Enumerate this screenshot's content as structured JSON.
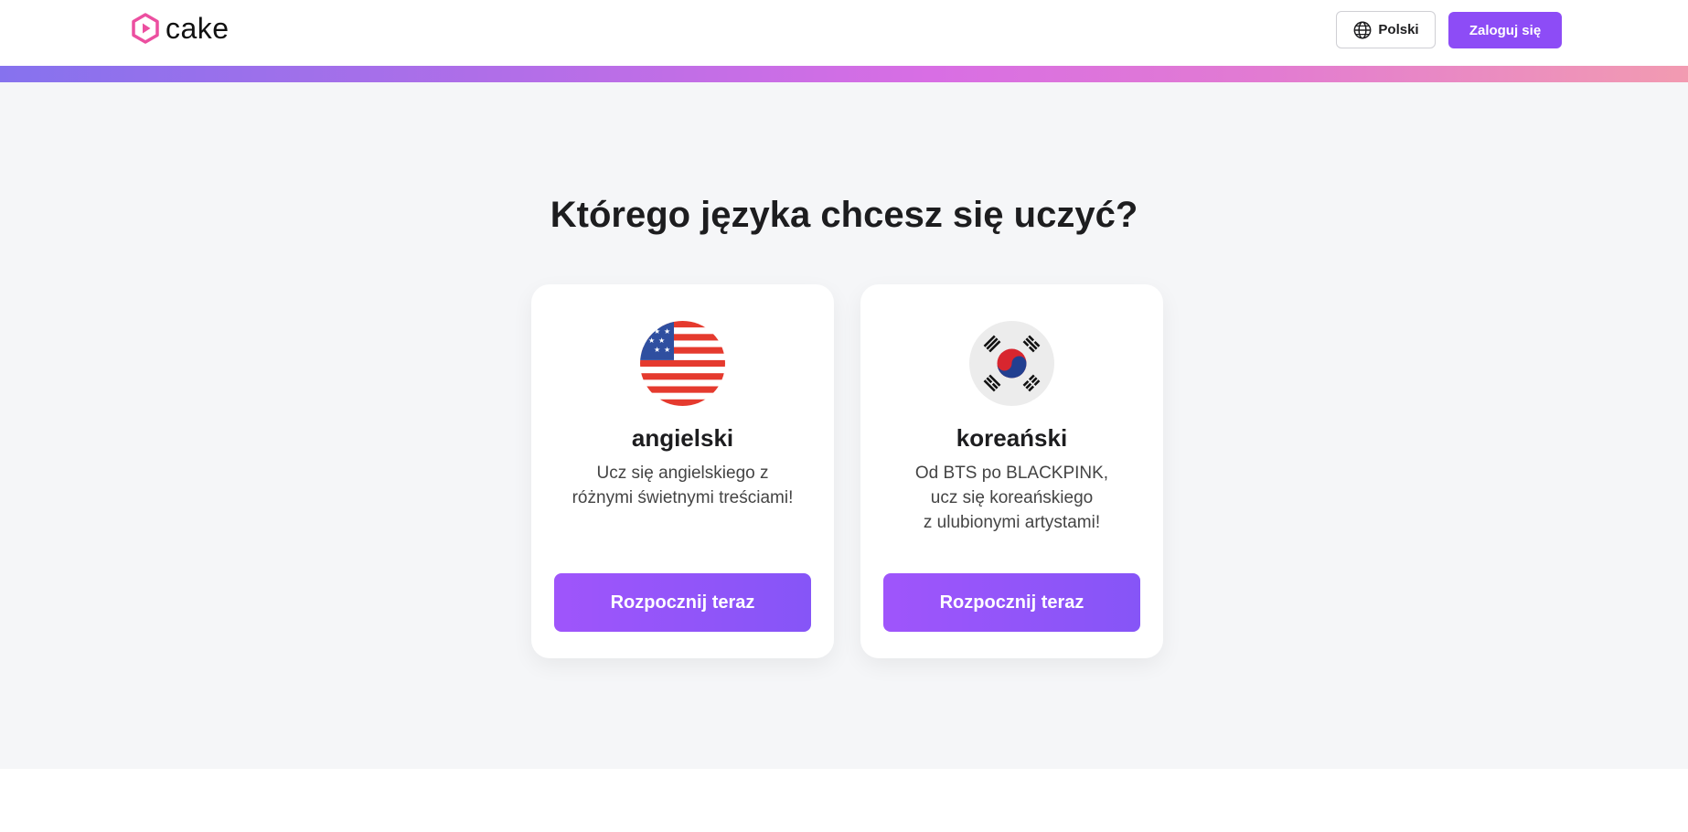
{
  "brand": {
    "name": "cake",
    "logo_icon": "hexagon-play-icon",
    "color": "#ec4fa0"
  },
  "header": {
    "language_button": {
      "label": "Polski",
      "icon": "globe-icon"
    },
    "login_button": {
      "label": "Zaloguj się"
    },
    "accent": "#8d4cf6"
  },
  "main": {
    "title": "Którego języka chcesz się uczyć?",
    "cards": [
      {
        "flag": "us-flag-icon",
        "title": "angielski",
        "description": "Ucz się angielskiego z\nróżnymi świetnymi treściami!",
        "button": "Rozpocznij teraz"
      },
      {
        "flag": "korea-flag-icon",
        "title": "koreański",
        "description": "Od BTS po BLACKPINK,\nucz się koreańskiego\nz ulubionymi artystami!",
        "button": "Rozpocznij teraz"
      }
    ]
  }
}
